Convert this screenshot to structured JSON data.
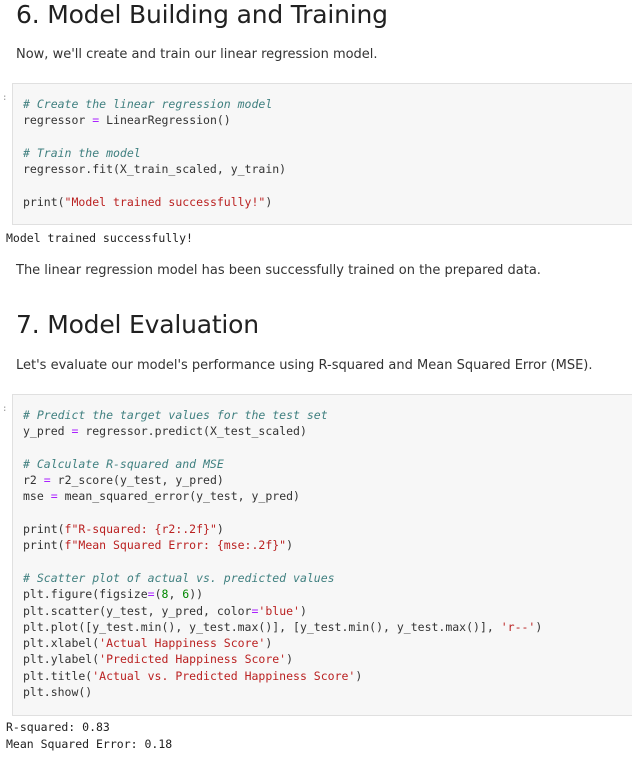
{
  "section6": {
    "heading": "6. Model Building and Training",
    "intro": "Now, we'll create and train our linear regression model.",
    "code": {
      "l1": "# Create the linear regression model",
      "l2a": "regressor ",
      "l2b": "=",
      "l2c": " LinearRegression()",
      "l3": "# Train the model",
      "l4": "regressor.fit(X_train_scaled, y_train)",
      "l5a": "print(",
      "l5b": "\"Model trained successfully!\"",
      "l5c": ")"
    },
    "output": "Model trained successfully!",
    "summary": "The linear regression model has been successfully trained on the prepared data."
  },
  "section7": {
    "heading": "7. Model Evaluation",
    "intro": "Let's evaluate our model's performance using R-squared and Mean Squared Error (MSE).",
    "code": {
      "c1": "# Predict the target values for the test set",
      "c2a": "y_pred ",
      "c2b": "=",
      "c2c": " regressor.predict(X_test_scaled)",
      "c3": "# Calculate R-squared and MSE",
      "c4a": "r2 ",
      "c4b": "=",
      "c4c": " r2_score(y_test, y_pred)",
      "c5a": "mse ",
      "c5b": "=",
      "c5c": " mean_squared_error(y_test, y_pred)",
      "c6a": "print(",
      "c6b": "f\"R-squared: {r2:.2f}\"",
      "c6c": ")",
      "c7a": "print(",
      "c7b": "f\"Mean Squared Error: {mse:.2f}\"",
      "c7c": ")",
      "c8": "# Scatter plot of actual vs. predicted values",
      "c9a": "plt.figure(figsize",
      "c9b": "=",
      "c9c": "(",
      "c9d": "8",
      "c9e": ", ",
      "c9f": "6",
      "c9g": "))",
      "c10a": "plt.scatter(y_test, y_pred, color",
      "c10b": "=",
      "c10c": "'blue'",
      "c10d": ")",
      "c11a": "plt.plot([y_test.min(), y_test.max()], [y_test.min(), y_test.max()], ",
      "c11b": "'r--'",
      "c11c": ")",
      "c12a": "plt.xlabel(",
      "c12b": "'Actual Happiness Score'",
      "c12c": ")",
      "c13a": "plt.ylabel(",
      "c13b": "'Predicted Happiness Score'",
      "c13c": ")",
      "c14a": "plt.title(",
      "c14b": "'Actual vs. Predicted Happiness Score'",
      "c14c": ")",
      "c15": "plt.show()"
    },
    "output1": "R-squared: 0.83",
    "output2": "Mean Squared Error: 0.18"
  },
  "prompt_marker": ":",
  "colors": {
    "comment": "#408080",
    "string": "#ba2121",
    "operator": "#aa22ff",
    "number": "#008800",
    "cell_bg": "#f7f7f7"
  }
}
